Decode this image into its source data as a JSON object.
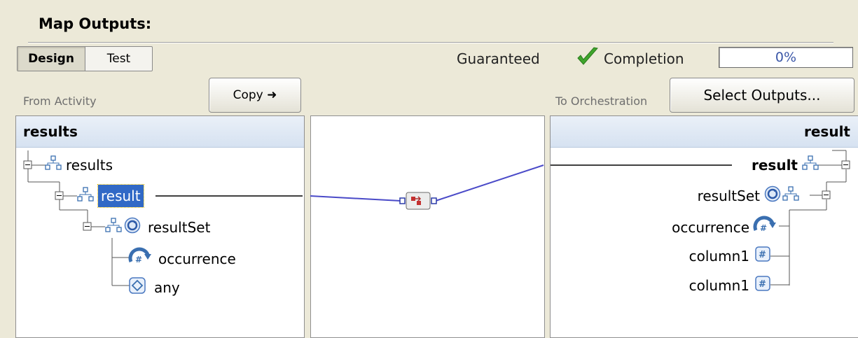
{
  "section": {
    "title": "Map Outputs:"
  },
  "tabs": [
    {
      "label": "Design",
      "active": true
    },
    {
      "label": "Test",
      "active": false
    }
  ],
  "status": {
    "guaranteed_label": "Guaranteed",
    "completion_label": "Completion",
    "progress": "0%",
    "check_color": "#3fa52c"
  },
  "left": {
    "caption": "From Activity",
    "copy_button": "Copy ➜",
    "header": "results",
    "tree": [
      {
        "label": "results",
        "icon": "schema-tree-icon"
      },
      {
        "label": "result",
        "icon": "schema-tree-icon",
        "selected": true
      },
      {
        "label": "resultSet",
        "icon": "repeating-icon"
      },
      {
        "label": "occurrence",
        "icon": "occurrence-icon"
      },
      {
        "label": "any",
        "icon": "any-element-icon"
      }
    ]
  },
  "right": {
    "caption": "To Orchestration",
    "select_button": "Select Outputs...",
    "header": "result",
    "tree": [
      {
        "label": "result",
        "icon": "schema-tree-icon"
      },
      {
        "label": "resultSet",
        "icon": "repeating-icon"
      },
      {
        "label": "occurrence",
        "icon": "occurrence-icon"
      },
      {
        "label": "column1",
        "icon": "number-field-icon"
      },
      {
        "label": "column1",
        "icon": "number-field-icon"
      }
    ]
  },
  "colors": {
    "selection": "#3169c6",
    "header": "#d6e2f1",
    "link_line": "#4a4ac8"
  }
}
